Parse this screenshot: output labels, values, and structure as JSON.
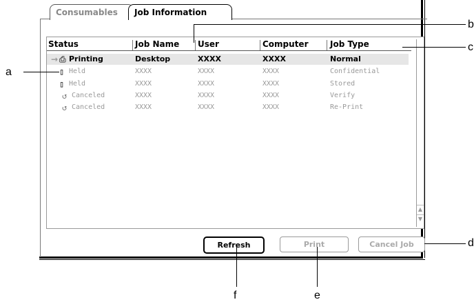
{
  "tabs": [
    {
      "label": "Consumables",
      "active": false
    },
    {
      "label": "Job Information",
      "active": true
    }
  ],
  "columns": [
    "Status",
    "Job Name",
    "User",
    "Computer",
    "Job Type"
  ],
  "rows": [
    {
      "status": "Printing",
      "job_name": "Desktop",
      "user": "XXXX",
      "computer": "XXXX",
      "job_type": "Normal",
      "icon": "printing-arrow-icon"
    },
    {
      "status": "Held",
      "job_name": "XXXX",
      "user": "XXXX",
      "computer": "XXXX",
      "job_type": "Confidential",
      "icon": "held-document-icon"
    },
    {
      "status": "Held",
      "job_name": "XXXX",
      "user": "XXXX",
      "computer": "XXXX",
      "job_type": "Stored",
      "icon": "held-document-icon"
    },
    {
      "status": "Canceled",
      "job_name": "XXXX",
      "user": "XXXX",
      "computer": "XXXX",
      "job_type": "Verify",
      "icon": "canceled-icon"
    },
    {
      "status": "Canceled",
      "job_name": "XXXX",
      "user": "XXXX",
      "computer": "XXXX",
      "job_type": "Re-Print",
      "icon": "canceled-icon"
    }
  ],
  "buttons": {
    "refresh": "Refresh",
    "print": "Print",
    "cancel_job": "Cancel Job"
  },
  "callouts": {
    "a": "a",
    "b": "b",
    "c": "c",
    "d": "d",
    "e": "e",
    "f": "f"
  }
}
